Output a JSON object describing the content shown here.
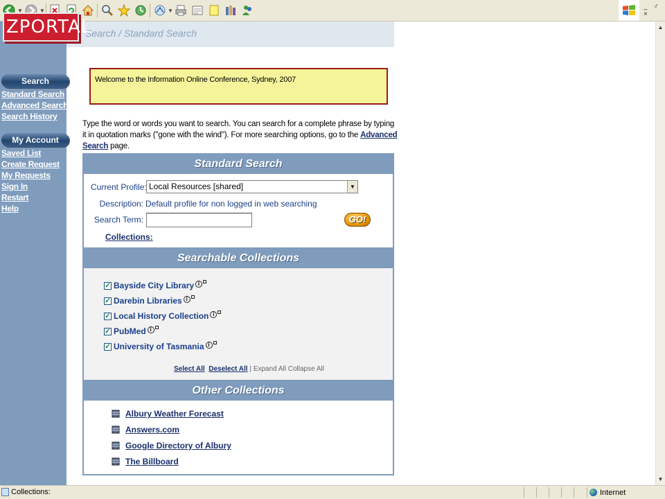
{
  "toolbar": {
    "icons": [
      "back-icon",
      "forward-icon",
      "stop-icon",
      "refresh-icon",
      "home-icon",
      "search-icon",
      "favorites-icon",
      "history-icon",
      "mail-icon",
      "print-icon",
      "edit-icon",
      "discuss-icon",
      "research-icon",
      "messenger-icon"
    ],
    "window_controls": "_ ♂ ×"
  },
  "logo": {
    "text": "ZPORTAL"
  },
  "nav": {
    "search_header": "Search",
    "search_links": [
      "Standard Search",
      "Advanced Search",
      "Search History"
    ],
    "account_header": "My Account",
    "account_links": [
      "Saved List",
      "Create Request",
      "My Requests",
      "Sign In",
      "Restart",
      "Help"
    ]
  },
  "breadcrumb": "Search / Standard Search",
  "welcome": "Welcome to the Information Online Conference, Sydney, 2007",
  "intro": {
    "text": "Type the word or words you want to search. You can search for a complete phrase by typing it in quotation marks (\"gone with the wind\"). For more searching options, go to the",
    "link": "Advanced Search",
    "suffix": "page."
  },
  "standard_search": {
    "title": "Standard Search",
    "profile_label": "Current Profile:",
    "profile_value": "Local Resources [shared]",
    "description_label": "Description:",
    "description_value": "Default profile for non logged in web searching",
    "search_label": "Search Term:",
    "search_value": "",
    "go_label": "GO!",
    "collections_label": "Collections:"
  },
  "searchable": {
    "title": "Searchable Collections",
    "items": [
      {
        "label": "Bayside City Library",
        "checked": true
      },
      {
        "label": "Darebin Libraries",
        "checked": true
      },
      {
        "label": "Local History Collection",
        "checked": true
      },
      {
        "label": "PubMed",
        "checked": true
      },
      {
        "label": "University of Tasmania",
        "checked": true
      }
    ],
    "select_all": "Select All",
    "deselect_all": "Deselect All",
    "expand_collapse": "| Expand All Collapse All"
  },
  "other": {
    "title": "Other Collections",
    "items": [
      "Albury Weather Forecast",
      "Answers.com",
      "Google Directory of Albury",
      "The Billboard"
    ]
  },
  "status": {
    "text": "Collections:",
    "zone": "Internet"
  },
  "colors": {
    "nav_bg": "#7f9cbd",
    "logo_red": "#cc1e2f",
    "welcome_bg": "#f5f49b",
    "link_blue": "#1a2f6c"
  }
}
